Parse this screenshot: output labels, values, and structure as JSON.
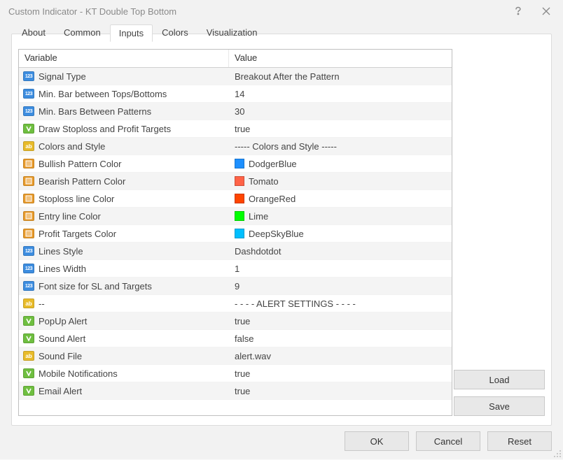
{
  "window": {
    "title": "Custom Indicator - KT Double Top Bottom"
  },
  "tabs": [
    {
      "label": "About"
    },
    {
      "label": "Common"
    },
    {
      "label": "Inputs",
      "active": true
    },
    {
      "label": "Colors"
    },
    {
      "label": "Visualization"
    }
  ],
  "table": {
    "headers": {
      "variable": "Variable",
      "value": "Value"
    },
    "rows": [
      {
        "type": "num",
        "name": "Signal Type",
        "value": "Breakout After the Pattern"
      },
      {
        "type": "num",
        "name": "Min. Bar between Tops/Bottoms",
        "value": "14"
      },
      {
        "type": "num",
        "name": "Min. Bars Between Patterns",
        "value": "30"
      },
      {
        "type": "bool",
        "name": "Draw Stoploss and Profit Targets",
        "value": "true"
      },
      {
        "type": "str",
        "name": "Colors and Style",
        "value": "----- Colors and Style -----"
      },
      {
        "type": "color",
        "name": "Bullish Pattern Color",
        "value": "DodgerBlue",
        "swatch": "#1e90ff"
      },
      {
        "type": "color",
        "name": "Bearish Pattern Color",
        "value": "Tomato",
        "swatch": "#ff6347"
      },
      {
        "type": "color",
        "name": "Stoploss line Color",
        "value": "OrangeRed",
        "swatch": "#ff4500"
      },
      {
        "type": "color",
        "name": "Entry line Color",
        "value": "Lime",
        "swatch": "#00ff00"
      },
      {
        "type": "color",
        "name": "Profit Targets Color",
        "value": "DeepSkyBlue",
        "swatch": "#00bfff"
      },
      {
        "type": "num",
        "name": "Lines Style",
        "value": "Dashdotdot"
      },
      {
        "type": "num",
        "name": "Lines Width",
        "value": "1"
      },
      {
        "type": "num",
        "name": "Font size for SL and Targets",
        "value": "9"
      },
      {
        "type": "str",
        "name": "--",
        "value": "- - - - ALERT SETTINGS - - - -"
      },
      {
        "type": "bool",
        "name": "PopUp Alert",
        "value": "true"
      },
      {
        "type": "bool",
        "name": "Sound Alert",
        "value": "false"
      },
      {
        "type": "str",
        "name": "Sound File",
        "value": "alert.wav"
      },
      {
        "type": "bool",
        "name": "Mobile Notifications",
        "value": "true"
      },
      {
        "type": "bool",
        "name": "Email Alert",
        "value": "true"
      }
    ]
  },
  "buttons": {
    "load": "Load",
    "save": "Save",
    "ok": "OK",
    "cancel": "Cancel",
    "reset": "Reset"
  }
}
